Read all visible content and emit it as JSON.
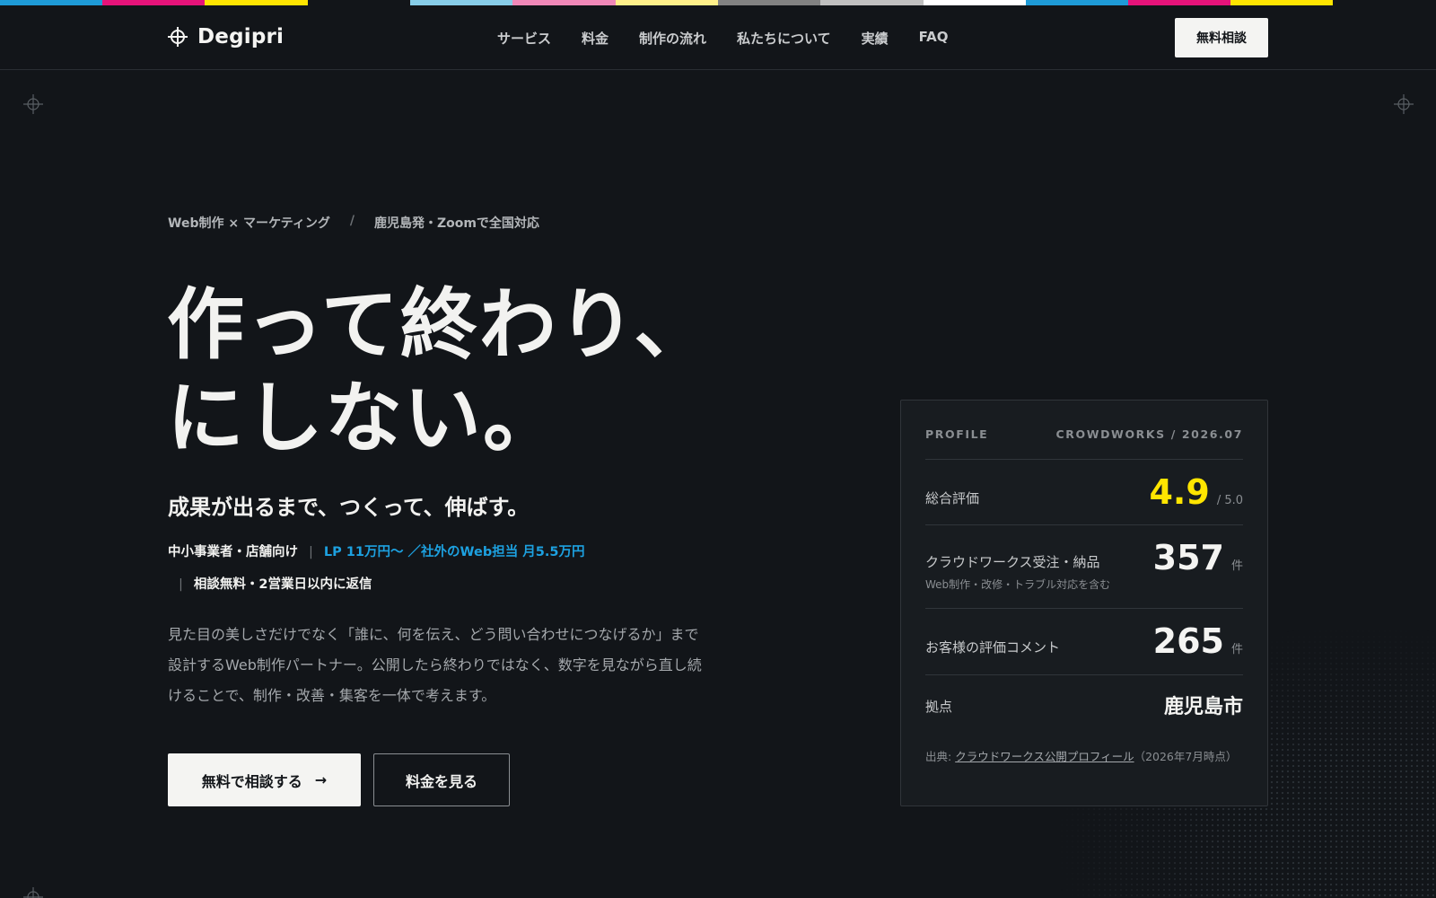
{
  "brand_colors": [
    "#1e9bd7",
    "#e6137a",
    "#ffe500",
    "#121519",
    "#87cde8",
    "#f088b8",
    "#fff08a",
    "#828282",
    "#c0c0c0",
    "#ffffff",
    "#1e9bd7",
    "#e6137a",
    "#ffe500"
  ],
  "header": {
    "logo_text": "Degipri",
    "nav": [
      "サービス",
      "料金",
      "制作の流れ",
      "私たちについて",
      "実績",
      "FAQ"
    ],
    "cta_label": "無料相談"
  },
  "hero": {
    "tag_left": "Web制作 × マーケティング",
    "tag_sep": "/",
    "tag_right": "鹿児島発・Zoomで全国対応",
    "headline_line1": "作って終わり、",
    "headline_line2": "にしない。",
    "subhead": "成果が出るまで、つくって、伸ばす。",
    "offer_target": "中小事業者・店舗向け",
    "offer_pipe": "|",
    "offer_lp": "LP 11万円〜 ／",
    "offer_web": "社外のWeb担当 月5.5万円",
    "offer_note": "相談無料・2営業日以内に返信",
    "description": "見た目の美しさだけでなく「誰に、何を伝え、どう問い合わせにつなげるか」まで設計するWeb制作パートナー。公開したら終わりではなく、数字を見ながら直し続けることで、制作・改善・集客を一体で考えます。",
    "primary_button": "無料で相談する",
    "primary_arrow": "→",
    "secondary_button": "料金を見る"
  },
  "profile": {
    "label": "PROFILE",
    "source_tag": "CROWDWORKS / 2026.07",
    "rating_label": "総合評価",
    "rating_value": "4.9",
    "rating_max": "/ 5.0",
    "orders_label": "クラウドワークス受注・納品",
    "orders_sub": "Web制作・改修・トラブル対応を含む",
    "orders_value": "357",
    "orders_unit": "件",
    "comments_label": "お客様の評価コメント",
    "comments_value": "265",
    "comments_unit": "件",
    "base_label": "拠点",
    "base_value": "鹿児島市",
    "source_prefix": "出典: ",
    "source_link": "クラウドワークス公開プロフィール",
    "source_suffix": "（2026年7月時点）"
  }
}
